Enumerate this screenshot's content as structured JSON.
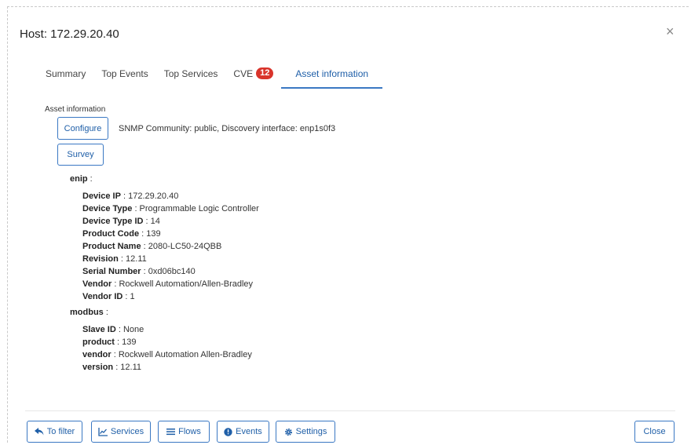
{
  "dialog": {
    "title": "Host: 172.29.20.40",
    "close_glyph": "×"
  },
  "tabs": [
    {
      "label": "Summary"
    },
    {
      "label": "Top Events"
    },
    {
      "label": "Top Services"
    },
    {
      "label": "CVE",
      "badge": "12"
    },
    {
      "label": "Asset information",
      "active": true
    }
  ],
  "asset": {
    "section_label": "Asset information",
    "configure_label": "Configure",
    "survey_label": "Survey",
    "snmp_info": "SNMP Community: public, Discovery interface: enp1s0f3",
    "enip": {
      "name": "enip",
      "sep": " :",
      "fields": [
        {
          "key": "Device IP",
          "value": " : 172.29.20.40"
        },
        {
          "key": "Device Type",
          "value": " : Programmable Logic Controller"
        },
        {
          "key": "Device Type ID",
          "value": " : 14"
        },
        {
          "key": "Product Code",
          "value": " : 139"
        },
        {
          "key": "Product Name",
          "value": " : 2080-LC50-24QBB"
        },
        {
          "key": "Revision",
          "value": " : 12.11"
        },
        {
          "key": "Serial Number",
          "value": " : 0xd06bc140"
        },
        {
          "key": "Vendor",
          "value": " : Rockwell Automation/Allen-Bradley"
        },
        {
          "key": "Vendor ID",
          "value": " : 1"
        }
      ]
    },
    "modbus": {
      "name": "modbus",
      "sep": " :",
      "fields": [
        {
          "key": "Slave ID",
          "value": " : None"
        },
        {
          "key": "product",
          "value": " : 139"
        },
        {
          "key": "vendor",
          "value": " : Rockwell Automation Allen-Bradley"
        },
        {
          "key": "version",
          "value": " : 12.11"
        }
      ]
    }
  },
  "footer": {
    "to_filter": "To filter",
    "services": "Services",
    "flows": "Flows",
    "events": "Events",
    "settings": "Settings",
    "close": "Close"
  },
  "icons": [
    "reply-arrow-icon",
    "line-chart-icon",
    "list-icon",
    "circle-info-icon",
    "gear-icon"
  ],
  "colors": {
    "accent": "#3a78c3",
    "badge": "#d9342b"
  }
}
